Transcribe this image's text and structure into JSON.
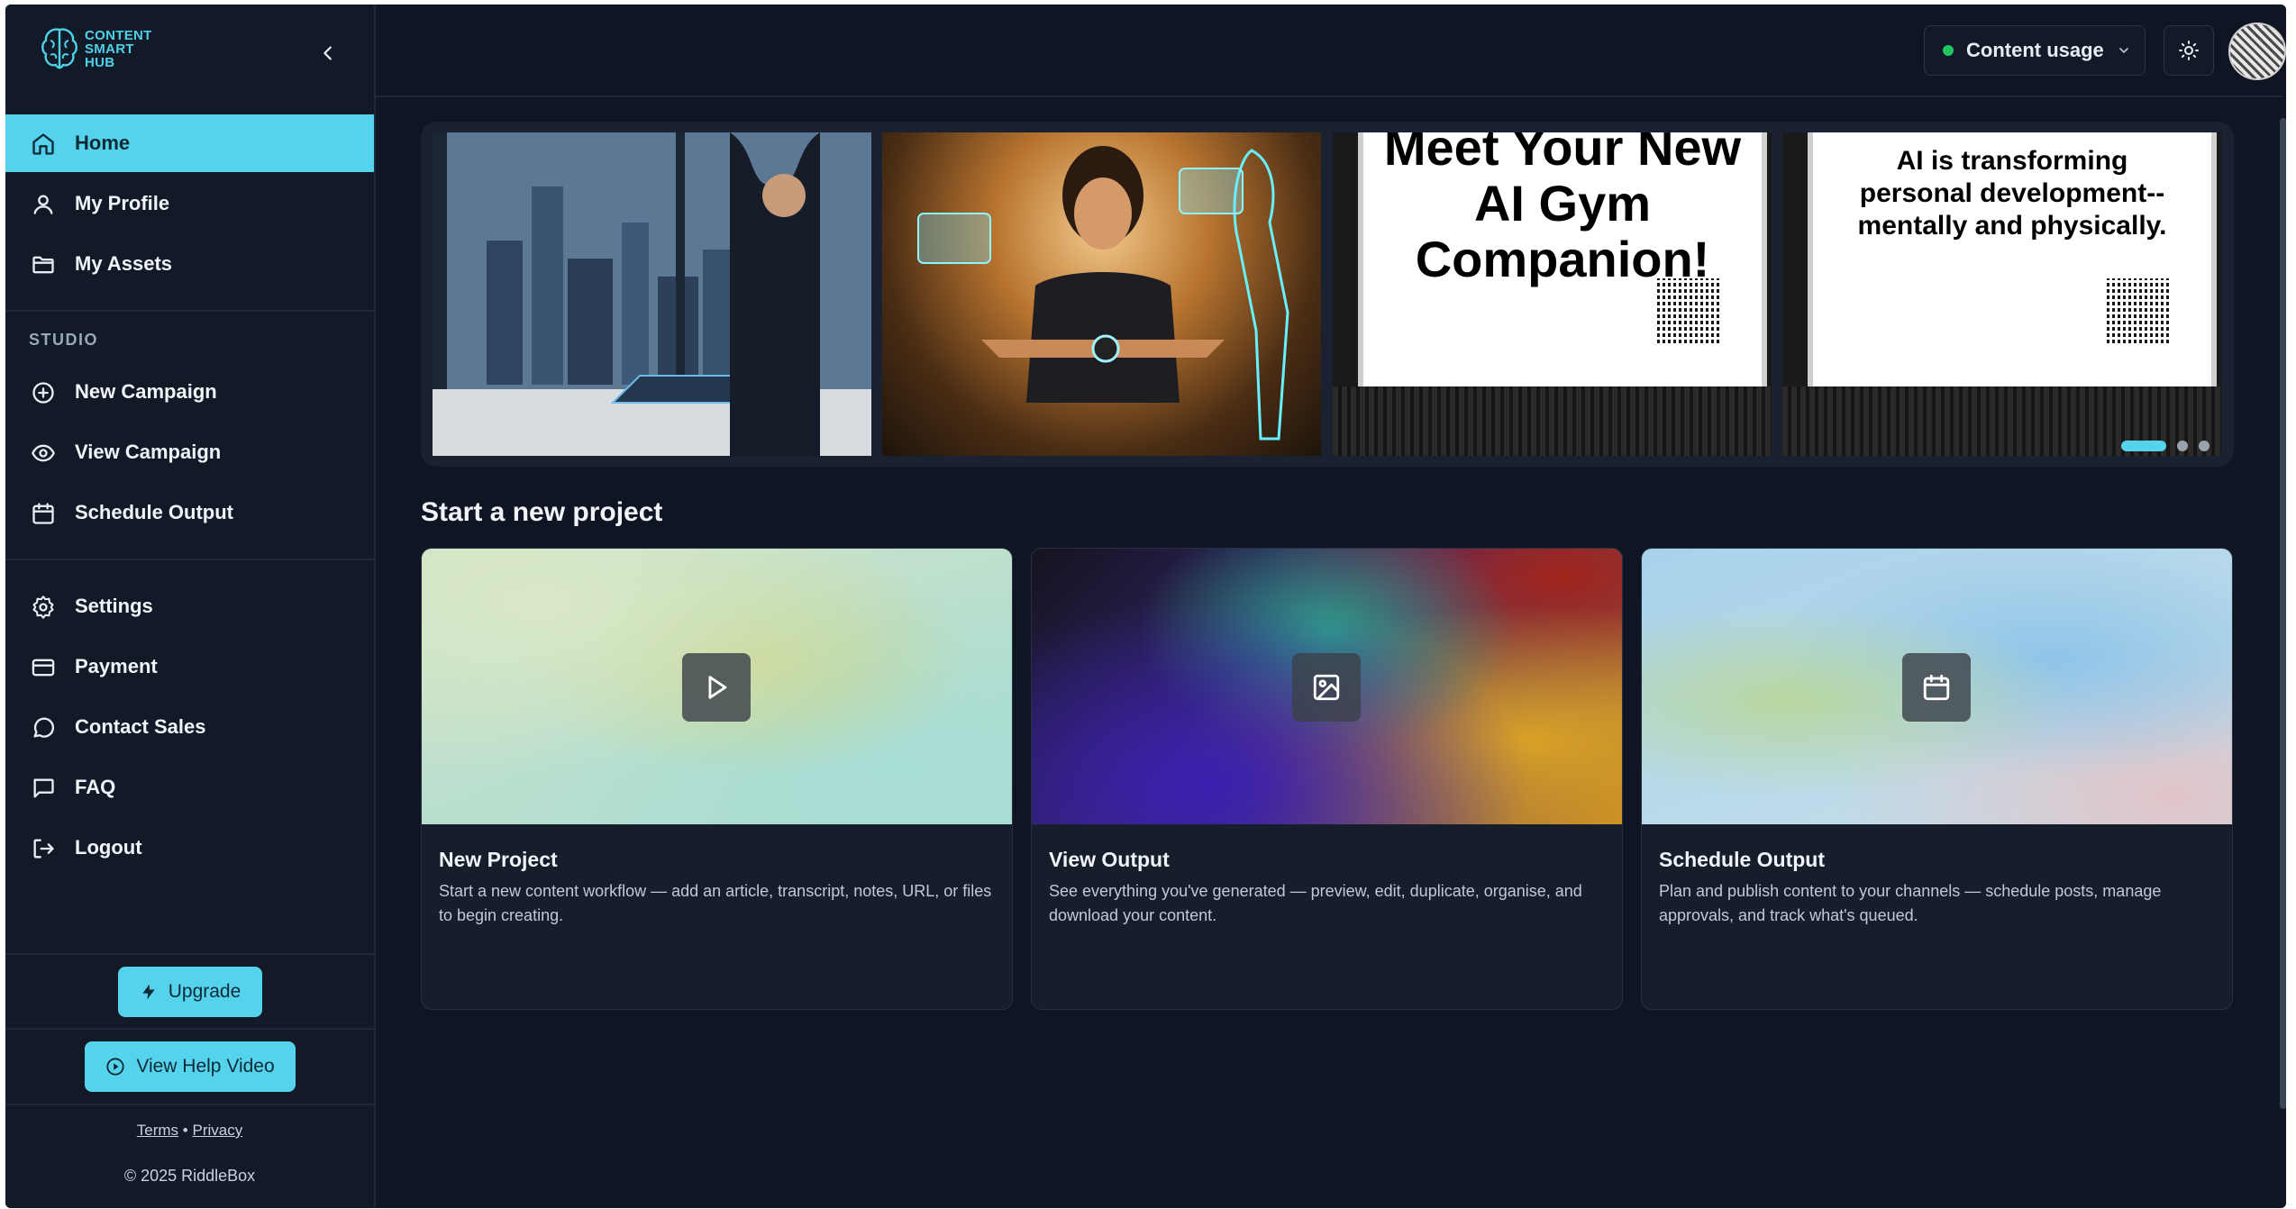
{
  "brand": {
    "logo_lines": [
      "CONTENT",
      "SMART",
      "HUB"
    ]
  },
  "sidebar": {
    "items": [
      {
        "label": "Home",
        "icon": "home-icon",
        "active": true
      },
      {
        "label": "My Profile",
        "icon": "user-icon"
      },
      {
        "label": "My Assets",
        "icon": "folder-icon"
      }
    ],
    "studio_label": "STUDIO",
    "studio_items": [
      {
        "label": "New Campaign",
        "icon": "plus-circle-icon"
      },
      {
        "label": "View Campaign",
        "icon": "eye-icon"
      },
      {
        "label": "Schedule Output",
        "icon": "calendar-icon"
      }
    ],
    "bottom_items": [
      {
        "label": "Settings",
        "icon": "gear-icon"
      },
      {
        "label": "Payment",
        "icon": "credit-card-icon"
      },
      {
        "label": "Contact Sales",
        "icon": "chat-bubble-icon"
      },
      {
        "label": "FAQ",
        "icon": "message-square-icon"
      },
      {
        "label": "Logout",
        "icon": "logout-icon"
      }
    ],
    "upgrade_label": "Upgrade",
    "help_label": "View Help Video",
    "terms": "Terms",
    "separator": "•",
    "privacy": "Privacy",
    "copyright": "© 2025 RiddleBox"
  },
  "header": {
    "usage_label": "Content usage",
    "usage_status_color": "#22c55e"
  },
  "carousel": {
    "slide3_text": "Meet Your New AI Gym Companion!",
    "slide4_text": "AI is transforming personal development--mentally and physically.",
    "slide_count": 3,
    "active_slide": 1
  },
  "main": {
    "section_title": "Start a new project",
    "cards": [
      {
        "title": "New Project",
        "description": "Start a new content workflow — add an article, transcript, notes, URL, or files to begin creating.",
        "icon": "play-icon"
      },
      {
        "title": "View Output",
        "description": "See everything you've generated — preview, edit, duplicate, organise, and download your content.",
        "icon": "image-icon"
      },
      {
        "title": "Schedule Output",
        "description": "Plan and publish content to your channels — schedule posts, manage approvals, and track what's queued.",
        "icon": "calendar-icon"
      }
    ]
  },
  "colors": {
    "accent": "#55d3ec",
    "background": "#0f1522",
    "sidebar": "#121a28"
  }
}
